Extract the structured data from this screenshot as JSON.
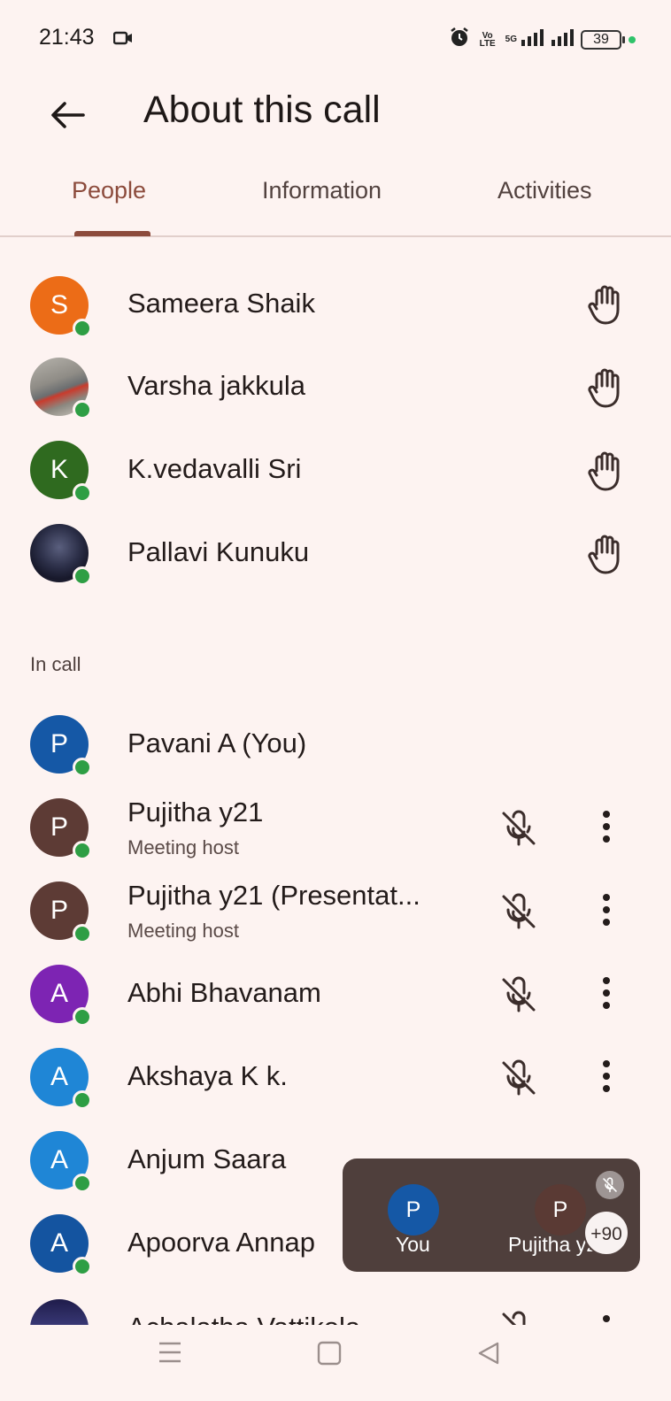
{
  "status": {
    "time": "21:43",
    "volte": "Vo\nLTE",
    "network": "5G",
    "battery": "39"
  },
  "header": {
    "title": "About this call",
    "back_icon": "arrow-back-icon"
  },
  "tabs": [
    {
      "label": "People",
      "active": true
    },
    {
      "label": "Information",
      "active": false
    },
    {
      "label": "Activities",
      "active": false
    }
  ],
  "raised_hands": [
    {
      "name": "Sameera Shaik",
      "initial": "S",
      "color": "#ec6c17",
      "photo": false
    },
    {
      "name": "Varsha jakkula",
      "initial": "",
      "photo": true
    },
    {
      "name": "K.vedavalli Sri",
      "initial": "K",
      "color": "#2f6a1f",
      "photo": false
    },
    {
      "name": "Pallavi Kunuku",
      "initial": "",
      "photo": true
    }
  ],
  "in_call": {
    "label": "In call",
    "people": [
      {
        "name": "Pavani A (You)",
        "initial": "P",
        "color": "#1558a6",
        "sub": ""
      },
      {
        "name": "Pujitha y21",
        "initial": "P",
        "color": "#5d3b35",
        "sub": "Meeting host"
      },
      {
        "name": "Pujitha y21 (Presentat...",
        "initial": "P",
        "color": "#5d3b35",
        "sub": "Meeting host"
      },
      {
        "name": "Abhi Bhavanam",
        "initial": "A",
        "color": "#7d24b3",
        "sub": ""
      },
      {
        "name": "Akshaya K k.",
        "initial": "A",
        "color": "#1f86d6",
        "sub": ""
      },
      {
        "name": "Anjum Saara",
        "initial": "A",
        "color": "#1f86d6",
        "sub": ""
      },
      {
        "name": "Apoorva Annap",
        "initial": "A",
        "color": "#1454a0",
        "sub": ""
      },
      {
        "name": "Achalatha Vattikola",
        "initial": "",
        "sub": ""
      }
    ]
  },
  "overlay": {
    "you_label": "You",
    "you_initial": "P",
    "you_color": "#1558a6",
    "other_label": "Pujitha y21",
    "other_initial": "P",
    "other_color": "#5a3a34",
    "more_count": "+90"
  }
}
